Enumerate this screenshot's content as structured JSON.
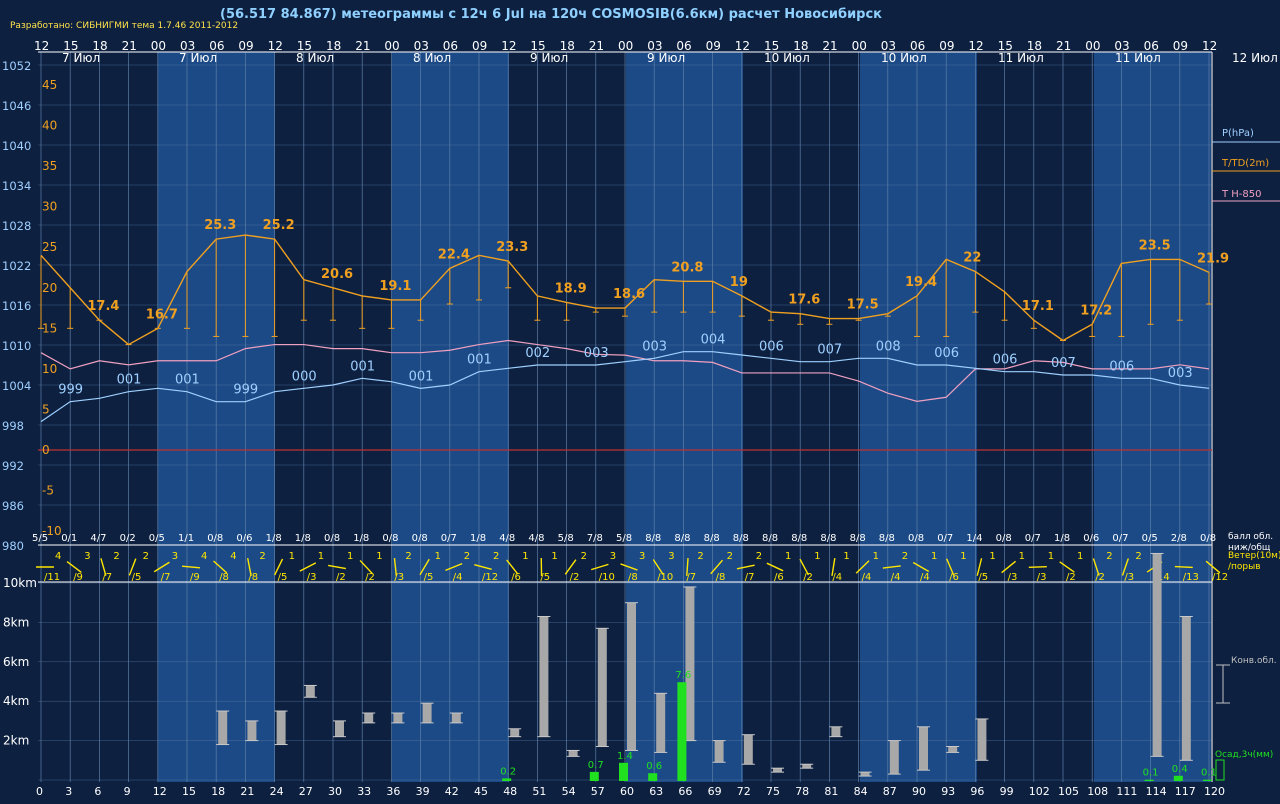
{
  "header": {
    "title": "(56.517 84.867) метеограммы с  12ч 6 Jul на 120ч COSMOSIB(6.6км) расчет Новосибирск",
    "credit": "Разработано: СИБНИГМИ тема 1.7.46 2011-2012"
  },
  "colors": {
    "background": "#0d2040",
    "band": "#1c4a86",
    "grid": "#5c7fa8",
    "pressure": "#9fd0ff",
    "temperature": "#f0a020",
    "t850": "#f0a0c0",
    "cloud_label": "#ffffff",
    "wind": "#ffe600",
    "precip": "#20e020",
    "conv_cloud": "#c0c0c0",
    "zero_line": "#c03030"
  },
  "chart_data": {
    "type": "meteogram",
    "hours_top": [
      "12",
      "15",
      "18",
      "21",
      "00",
      "03",
      "06",
      "09",
      "12",
      "15",
      "18",
      "21",
      "00",
      "03",
      "06",
      "09",
      "12",
      "15",
      "18",
      "21",
      "00",
      "03",
      "06",
      "09",
      "12",
      "15",
      "18",
      "21",
      "00",
      "03",
      "06",
      "09",
      "12",
      "15",
      "18",
      "21",
      "00",
      "03",
      "06",
      "09",
      "12"
    ],
    "date_labels": [
      "7 Июл",
      "7 Июл",
      "8 Июл",
      "8 Июл",
      "9 Июл",
      "9 Июл",
      "10 Июл",
      "10 Июл",
      "11 Июл",
      "11 Июл",
      "12 Июл"
    ],
    "pressure_ticks": [
      "1052",
      "1046",
      "1040",
      "1034",
      "1028",
      "1022",
      "1016",
      "1010",
      "1004",
      "998",
      "992",
      "986",
      "980"
    ],
    "temp_ticks": [
      "45",
      "40",
      "35",
      "30",
      "25",
      "20",
      "15",
      "10",
      "5",
      "0",
      "-5",
      "-10"
    ],
    "legend": {
      "p": "P(hPa)",
      "t": "T/TD(2m)",
      "t850": "T H-850",
      "cloud": "балл обл.\nниж/общ",
      "wind": "Ветер(10м)\n/порыв",
      "conv": "Конв.обл.",
      "precip": "Осад,3ч(мм)"
    },
    "hours_lead": [
      0,
      3,
      6,
      9,
      12,
      15,
      18,
      21,
      24,
      27,
      30,
      33,
      36,
      39,
      42,
      45,
      48,
      51,
      54,
      57,
      60,
      63,
      66,
      69,
      72,
      75,
      78,
      81,
      84,
      87,
      90,
      93,
      96,
      99,
      102,
      105,
      108,
      111,
      114,
      117,
      120
    ],
    "height_ticks": [
      "10km",
      "8km",
      "6km",
      "4km",
      "2km"
    ],
    "temperature": [
      24,
      20,
      16,
      13,
      15,
      22,
      26,
      26.5,
      26,
      21,
      20,
      19,
      18.5,
      18.5,
      22.4,
      24,
      23.3,
      19,
      18.2,
      17.5,
      17.5,
      21,
      20.8,
      20.8,
      19,
      17,
      16.8,
      16.2,
      16.2,
      16.8,
      19,
      23.5,
      22,
      19.5,
      16,
      13.5,
      15.5,
      23,
      23.5,
      23.5,
      21.9
    ],
    "temp_labels": [
      null,
      null,
      "17.4",
      null,
      "16.7",
      null,
      "25.3",
      null,
      "25.2",
      null,
      "20.6",
      null,
      "19.1",
      null,
      "22.4",
      null,
      "23.3",
      null,
      "18.9",
      null,
      "18.6",
      null,
      "20.8",
      null,
      "19",
      null,
      "17.6",
      null,
      "17.5",
      null,
      "19.4",
      null,
      "22",
      null,
      "17.1",
      null,
      "17.2",
      null,
      "23.5",
      null,
      "21.9"
    ],
    "gusts": [
      15,
      15,
      16,
      13,
      15,
      15,
      14,
      14,
      14,
      16,
      16,
      15,
      15,
      16,
      18,
      18.5,
      20,
      16,
      16,
      17,
      16.5,
      17,
      17,
      17,
      16.5,
      16,
      15.5,
      15.5,
      16,
      16.5,
      14,
      14,
      17,
      16,
      15,
      13.5,
      14,
      14,
      15.5,
      16,
      18
    ],
    "pressure": [
      998.5,
      1001.5,
      1002,
      1003,
      1003.5,
      1003,
      1001.5,
      1001.5,
      1003,
      1003.5,
      1004,
      1005,
      1004.5,
      1003.5,
      1004,
      1006,
      1006.5,
      1007,
      1007,
      1007,
      1007.5,
      1008,
      1009,
      1009,
      1008.5,
      1008,
      1007.5,
      1007.5,
      1008,
      1008,
      1007,
      1007,
      1006.5,
      1006,
      1006,
      1005.5,
      1005.5,
      1005,
      1005,
      1004,
      1003.5
    ],
    "pressure_labels": [
      null,
      "999",
      null,
      "001",
      null,
      "001",
      null,
      "999",
      null,
      "000",
      null,
      "001",
      null,
      "001",
      null,
      "001",
      null,
      "002",
      null,
      "003",
      null,
      "003",
      null,
      "004",
      null,
      "006",
      null,
      "007",
      null,
      "008",
      null,
      "006",
      null,
      "006",
      null,
      "007",
      null,
      "006",
      null,
      "003",
      null
    ],
    "t850": [
      12,
      10,
      11,
      10.5,
      11,
      11,
      11,
      12.5,
      13,
      13,
      12.5,
      12.5,
      12,
      12,
      12.3,
      13,
      13.5,
      13,
      12.5,
      11.8,
      11.7,
      11,
      11,
      10.8,
      9.5,
      9.5,
      9.5,
      9.5,
      8.5,
      7,
      6,
      6.5,
      10,
      10,
      11,
      10.8,
      10,
      10,
      10,
      10.5,
      10
    ],
    "cloud": [
      "5/5",
      "0/1",
      "4/7",
      "0/2",
      "0/5",
      "1/1",
      "0/8",
      "0/6",
      "1/8",
      "1/8",
      "0/8",
      "1/8",
      "0/8",
      "0/8",
      "0/7",
      "1/8",
      "4/8",
      "4/8",
      "5/8",
      "7/8",
      "5/8",
      "8/8",
      "8/8",
      "8/8",
      "8/8",
      "8/8",
      "8/8",
      "8/8",
      "8/8",
      "8/8",
      "0/8",
      "0/7",
      "1/4",
      "0/8",
      "0/7",
      "1/8",
      "0/6",
      "0/7",
      "0/5",
      "2/8",
      "0/8"
    ],
    "wind_speed": [
      "4",
      "3",
      "2",
      "2",
      "3",
      "4",
      "4",
      "2",
      "1",
      "1",
      "1",
      "1",
      "2",
      "1",
      "2",
      "2",
      "1",
      "1",
      "2",
      "3",
      "3",
      "3",
      "2",
      "2",
      "2",
      "1",
      "1",
      "1",
      "1",
      "2",
      "1",
      "1",
      "1",
      "1",
      "1",
      "1",
      "2",
      "2"
    ],
    "wind_gust": [
      "/11",
      "/9",
      "/7",
      "/5",
      "/7",
      "/9",
      "/8",
      "/8",
      "/5",
      "/3",
      "/2",
      "/2",
      "/3",
      "/5",
      "/4",
      "/12",
      "/6",
      "/5",
      "/2",
      "/10",
      "/8",
      "/10",
      "/7",
      "/8",
      "/7",
      "/6",
      "/2",
      "/4",
      "/4",
      "/4",
      "/4",
      "/6",
      "/5",
      "/3",
      "/3",
      "/2",
      "/2",
      "/3",
      "/14",
      "/13",
      "/12"
    ],
    "conv_clouds": [
      [
        18,
        1.8,
        3.5
      ],
      [
        21,
        2,
        3
      ],
      [
        24,
        1.8,
        3.5
      ],
      [
        27,
        4.2,
        4.8
      ],
      [
        30,
        2.2,
        3
      ],
      [
        33,
        2.9,
        3.4
      ],
      [
        36,
        2.9,
        3.4
      ],
      [
        39,
        2.9,
        3.9
      ],
      [
        42,
        2.9,
        3.4
      ],
      [
        48,
        2.2,
        2.6
      ],
      [
        51,
        2.2,
        8.3
      ],
      [
        54,
        1.2,
        1.5
      ],
      [
        57,
        1.7,
        7.7
      ],
      [
        60,
        1.5,
        9.0
      ],
      [
        63,
        1.4,
        4.4
      ],
      [
        66,
        2.0,
        9.8
      ],
      [
        69,
        0.9,
        2.0
      ],
      [
        72,
        0.8,
        2.3
      ],
      [
        75,
        0.4,
        0.6
      ],
      [
        78,
        0.6,
        0.8
      ],
      [
        81,
        2.2,
        2.7
      ],
      [
        84,
        0.2,
        0.4
      ],
      [
        87,
        0.3,
        2.0
      ],
      [
        90,
        0.5,
        2.7
      ],
      [
        93,
        1.4,
        1.7
      ],
      [
        96,
        1.0,
        3.1
      ],
      [
        114,
        1.2,
        11.5
      ],
      [
        117,
        1.0,
        8.3
      ]
    ],
    "precip": [
      [
        48,
        0.2
      ],
      [
        57,
        0.7
      ],
      [
        60,
        1.4
      ],
      [
        63,
        0.6
      ],
      [
        66,
        7.6
      ],
      [
        114,
        0.1
      ],
      [
        117,
        0.4
      ],
      [
        120,
        0.1
      ]
    ]
  }
}
